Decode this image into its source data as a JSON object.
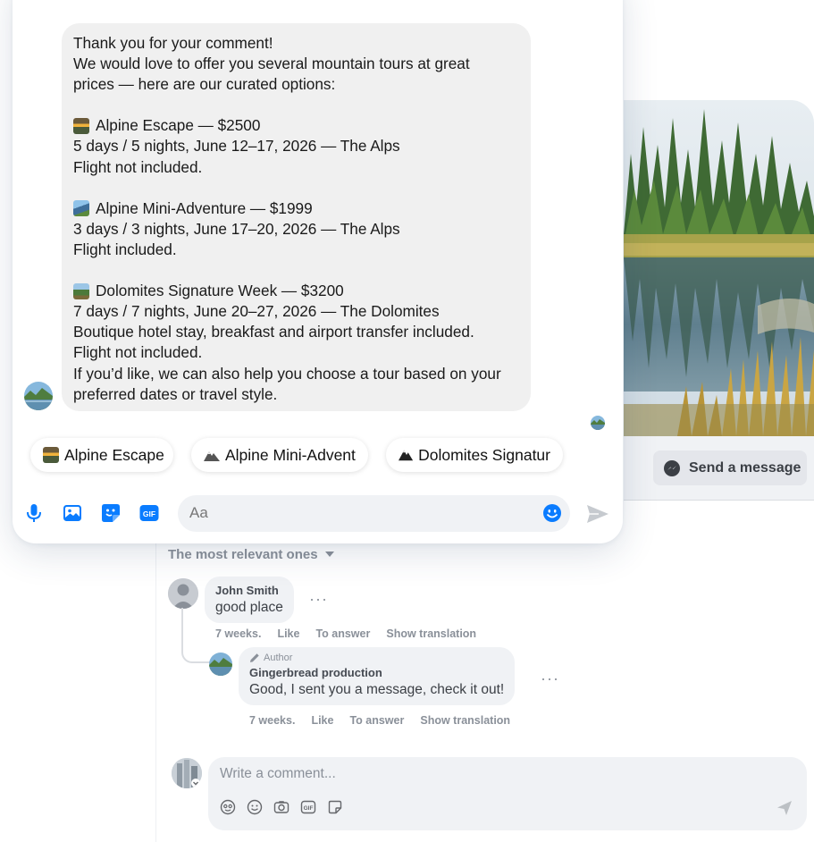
{
  "post": {
    "send_message_label": "Send a message",
    "sort_label": "The most relevant ones"
  },
  "comments": [
    {
      "name": "John Smith",
      "text": "good place",
      "time": "7 weeks.",
      "like": "Like",
      "reply": "To answer",
      "translate": "Show translation"
    }
  ],
  "reply": {
    "badge": "Author",
    "name": "Gingerbread production",
    "text": "Good, I sent you a message, check it out!",
    "time": "7 weeks.",
    "like": "Like",
    "reply": "To answer",
    "translate": "Show translation"
  },
  "write_comment": {
    "placeholder": "Write a comment..."
  },
  "messenger": {
    "message_lines": [
      "Thank you for your comment!",
      "We would love to offer you several mountain tours at great",
      "prices — here are our curated options:",
      "",
      "Alpine Escape — $2500",
      "5 days / 5 nights, June 12–17, 2026 — The Alps",
      "Flight not included.",
      "",
      "Alpine Mini-Adventure — $1999",
      "3 days / 3 nights, June 17–20, 2026 — The Alps",
      "Flight included.",
      "",
      "Dolomites Signature Week — $3200",
      "7 days / 7 nights, June 20–27, 2026 — The Dolomites",
      "Boutique hotel stay, breakfast and airport transfer included.",
      "Flight not included.",
      "If you’d like, we can also help you choose a tour based on your",
      "preferred dates or travel style."
    ],
    "quick_replies": [
      {
        "label": "Alpine Escape",
        "icon": "sunrise-icon"
      },
      {
        "label": "Alpine Mini-Advent",
        "icon": "mountain-icon"
      },
      {
        "label": "Dolomites Signatur",
        "icon": "mountain-icon"
      }
    ],
    "composer_placeholder": "Aa",
    "accent_color": "#0a7cff"
  }
}
